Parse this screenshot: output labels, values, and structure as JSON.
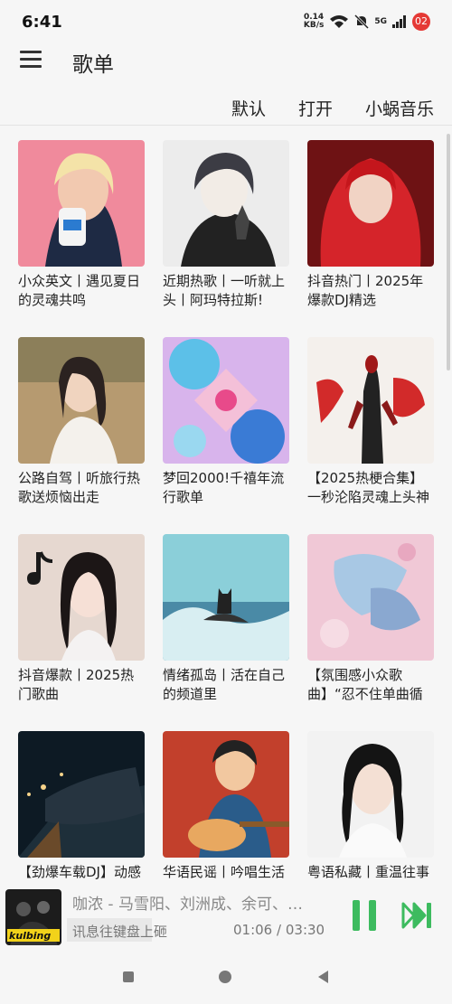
{
  "status": {
    "time": "6:41",
    "net_speed": "0.14",
    "net_unit": "KB/s",
    "signal": "5G",
    "badge": "02"
  },
  "header": {
    "title": "歌单",
    "menu_icon": "hamburger-icon"
  },
  "sort": {
    "default": "默认",
    "open": "打开",
    "source": "小蜗音乐"
  },
  "playlists": [
    {
      "title": "小众英文丨遇见夏日的灵魂共鸣"
    },
    {
      "title": "近期热歌丨一听就上头丨阿玛特拉斯!"
    },
    {
      "title": "抖音热门丨2025年爆款DJ精选"
    },
    {
      "title": "公路自驾丨听旅行热歌送烦恼出走"
    },
    {
      "title": "梦回2000!千禧年流行歌单"
    },
    {
      "title": "【2025热梗合集】一秒沦陷灵魂上头神曲"
    },
    {
      "title": "抖音爆款丨2025热门歌曲"
    },
    {
      "title": "情绪孤岛丨活在自己的频道里"
    },
    {
      "title": "【氛围感小众歌曲】“忍不住单曲循环!”"
    },
    {
      "title": "【劲爆车载DJ】动感"
    },
    {
      "title": "华语民谣丨吟唱生活"
    },
    {
      "title": "粤语私藏丨重温往事"
    }
  ],
  "player": {
    "song": "咖浓 - 马雪阳、刘洲成、余可、…",
    "lyric": "讯息往键盘上砸",
    "current_time": "01:06",
    "separator": "/",
    "total_time": "03:30",
    "progress": 0.314,
    "cover_text": "kulbing",
    "accent": "#3dbb5f"
  }
}
